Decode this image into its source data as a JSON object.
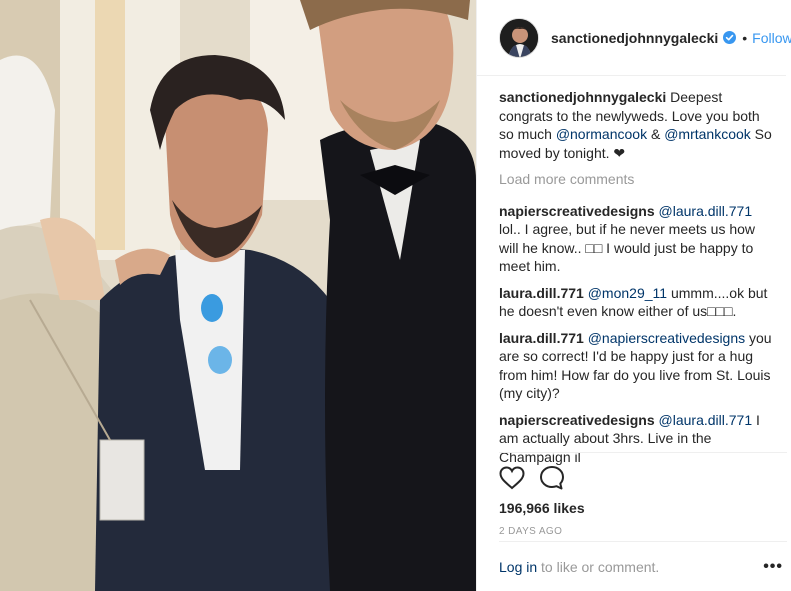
{
  "post": {
    "photo_alt": "",
    "header": {
      "username": "sanctionedjohnnygalecki",
      "separator": "•",
      "follow_label": "Follow"
    },
    "caption": {
      "user": "sanctionedjohnnygalecki",
      "text1": " Deepest congrats to the newlyweds. Love you both so much ",
      "mention1": "@normancook",
      "text2": " & ",
      "mention2": "@mrtankcook",
      "text3": " So moved by tonight. ❤"
    },
    "load_more_label": "Load more comments",
    "comments": [
      {
        "user": "napierscreativedesigns",
        "mention": "@laura.dill.771",
        "text": " lol.. I agree, but if he never meets us how will he know.. □□ I would just be happy to meet him."
      },
      {
        "user": "laura.dill.771",
        "mention": "@mon29_11",
        "text": " ummm....ok but he doesn't even know either of us□□□."
      },
      {
        "user": "laura.dill.771",
        "mention": "@napierscreativedesigns",
        "text": " you are so correct! I'd be happy just for a hug from him! How far do you live from St. Louis (my city)?"
      },
      {
        "user": "napierscreativedesigns",
        "mention": "@laura.dill.771",
        "text": " I am actually about 3hrs. Live in the Champaign il"
      }
    ],
    "icons": {
      "like": "heart-icon",
      "comment": "comment-bubble-icon",
      "verified": "verified-badge-icon",
      "more": "more-options-icon"
    },
    "likes_label": "196,966 likes",
    "time_label": "2 DAYS AGO",
    "footer": {
      "login_label": "Log in",
      "login_suffix": " to like or comment.",
      "more_label": "•••"
    },
    "colors": {
      "link_blue": "#3897f0",
      "mention_navy": "#003569",
      "muted_gray": "#999999",
      "text_dark": "#262626"
    }
  }
}
